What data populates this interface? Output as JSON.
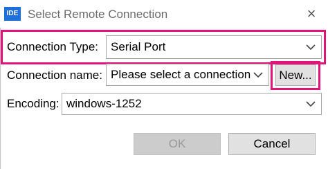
{
  "window": {
    "app_icon_text": "IDE",
    "title": "Select Remote Connection",
    "close_glyph": "×"
  },
  "connection_type": {
    "label": "Connection Type:",
    "value": "Serial Port",
    "highlighted": true
  },
  "connection_name": {
    "label": "Connection name:",
    "value": "Please select a connection",
    "new_button": "New...",
    "new_button_highlighted": true
  },
  "encoding": {
    "label": "Encoding:",
    "value": "windows-1252"
  },
  "buttons": {
    "ok": "OK",
    "ok_enabled": false,
    "cancel": "Cancel"
  },
  "colors": {
    "highlight": "#e0157a",
    "app_icon": "#1e6fd9"
  },
  "icons": {
    "dropdown": "chevron-down-icon",
    "close": "close-icon"
  }
}
